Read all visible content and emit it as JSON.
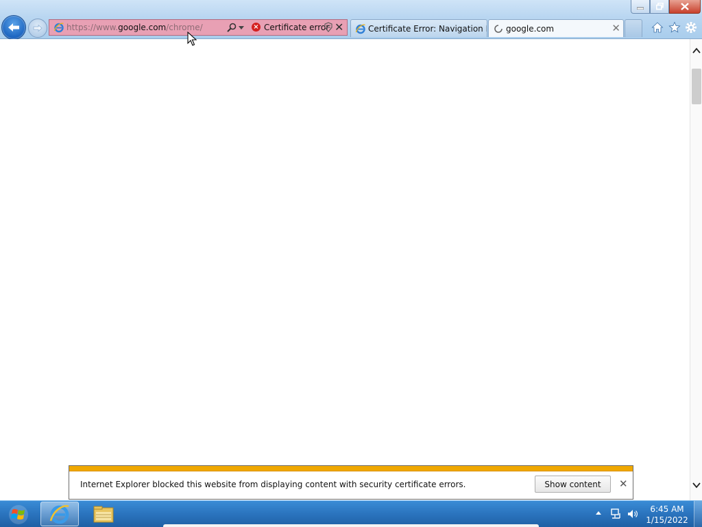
{
  "browser": {
    "address_bar": {
      "url_prefix": "https://www.",
      "url_domain": "google.com",
      "url_path": "/chrome/",
      "cert_label": "Certificate error"
    },
    "tabs": [
      {
        "label": "Certificate Error: Navigation Bl...",
        "active": false
      },
      {
        "label": "google.com",
        "active": true,
        "loading": true
      }
    ],
    "command_icons": [
      "home-icon",
      "favorites-star-icon",
      "tools-gear-icon"
    ]
  },
  "notification": {
    "message": "Internet Explorer blocked this website from displaying content with security certificate errors.",
    "button_label": "Show content",
    "stripe_color": "#f0a800"
  },
  "taskbar": {
    "pinned": [
      "internet-explorer-icon",
      "file-explorer-icon"
    ],
    "clock_time": "6:45 AM",
    "clock_date": "1/15/2022"
  }
}
